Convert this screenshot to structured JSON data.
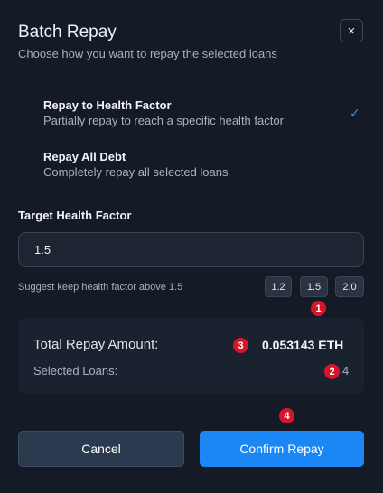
{
  "dialog": {
    "title": "Batch Repay",
    "subtitle": "Choose how you want to repay the selected loans",
    "close_icon": "×"
  },
  "options": [
    {
      "label": "Repay to Health Factor",
      "description": "Partially repay to reach a specific health factor",
      "selected": true
    },
    {
      "label": "Repay All Debt",
      "description": "Completely repay all selected loans",
      "selected": false
    }
  ],
  "check_icon": "✓",
  "target": {
    "label": "Target Health Factor",
    "value": "1.5",
    "hint": "Suggest keep health factor above 1.5",
    "presets": [
      "1.2",
      "1.5",
      "2.0"
    ]
  },
  "markers": [
    "1",
    "2",
    "3",
    "4"
  ],
  "summary": {
    "total_label": "Total Repay Amount:",
    "total_value": "0.053143 ETH",
    "loans_label": "Selected Loans:",
    "loans_value": "4"
  },
  "buttons": {
    "cancel": "Cancel",
    "confirm": "Confirm Repay"
  },
  "colors": {
    "accent": "#1a87f5",
    "marker": "#d6152a",
    "background": "#141b27"
  }
}
